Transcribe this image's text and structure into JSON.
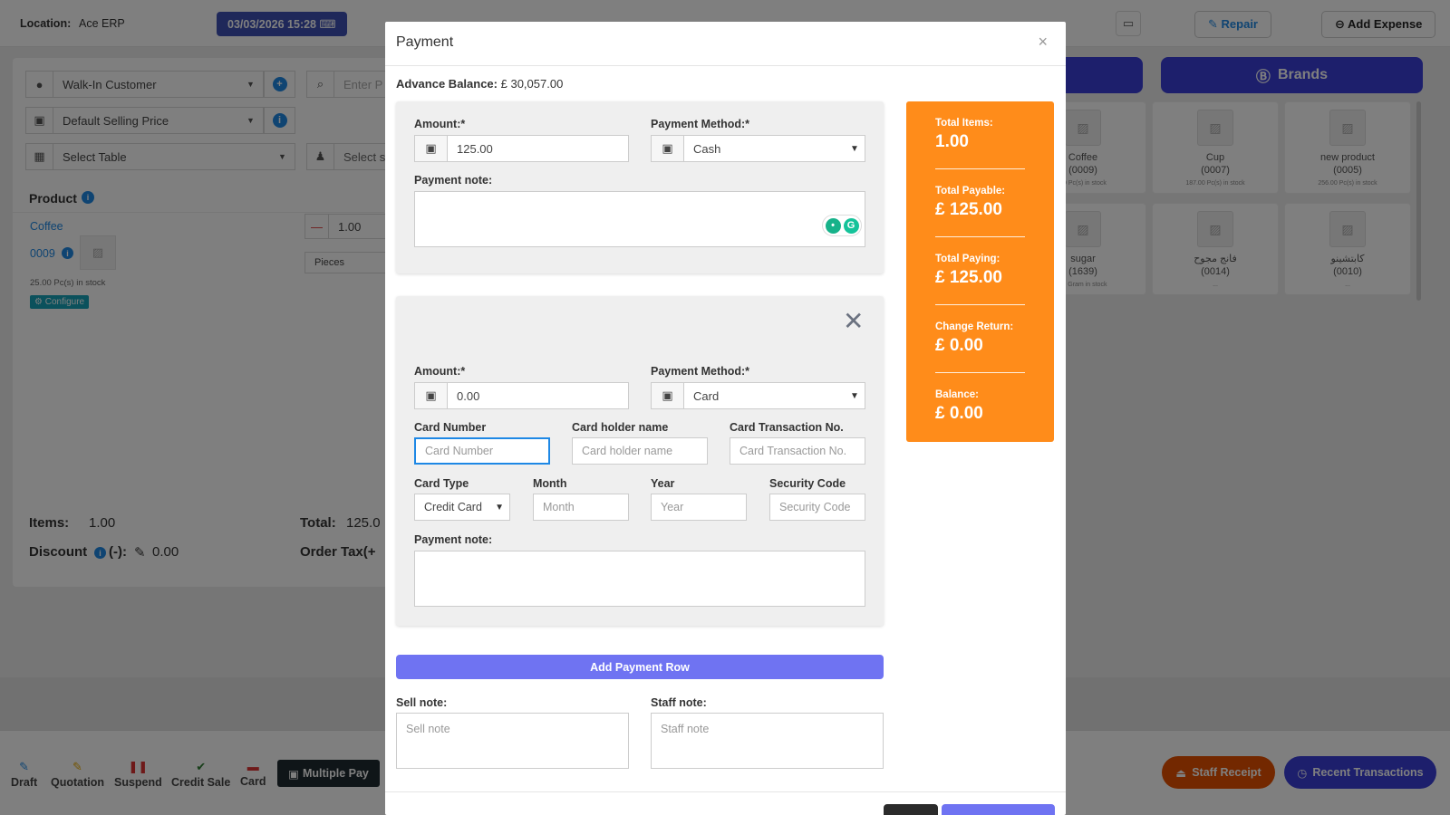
{
  "header": {
    "location_label": "Location:",
    "location_value": "Ace ERP",
    "datetime": "03/03/2026 15:28",
    "repair_label": "Repair",
    "add_expense_label": "Add Expense"
  },
  "left_panel": {
    "customer": "Walk-In Customer",
    "price_group": "Default Selling Price",
    "table_placeholder": "Select Table",
    "search_placeholder": "Enter P",
    "service_placeholder": "Select s",
    "product_header": "Product",
    "product_name": "Coffee",
    "product_code": "0009",
    "product_stock": "25.00 Pc(s) in stock",
    "configure_label": "Configure",
    "qty_value": "1.00",
    "unit": "Pieces",
    "items_label": "Items:",
    "items_value": "1.00",
    "total_label": "Total:",
    "total_value": "125.0",
    "discount_label": "Discount",
    "discount_sign": "(-):",
    "discount_value": "0.00",
    "order_tax_label": "Order Tax(+"
  },
  "right_panel": {
    "brands_label": "Brands",
    "products": [
      {
        "name": "Coffee",
        "code": "(0009)",
        "stock": "00 Pc(s) in stock"
      },
      {
        "name": "Cup",
        "code": "(0007)",
        "stock": "187.00 Pc(s) in stock"
      },
      {
        "name": "new product",
        "code": "(0005)",
        "stock": "256.00 Pc(s) in stock"
      },
      {
        "name": "sugar",
        "code": "(1639)",
        "stock": "00 Gram in stock"
      },
      {
        "name": "فانج مجوح",
        "code": "(0014)",
        "stock": "..."
      },
      {
        "name": "كابتشينو",
        "code": "(0010)",
        "stock": "..."
      }
    ]
  },
  "bottom_bar": {
    "draft": "Draft",
    "quotation": "Quotation",
    "suspend": "Suspend",
    "credit_sale": "Credit Sale",
    "card": "Card",
    "multiple_pay": "Multiple Pay",
    "staff_receipt": "Staff Receipt",
    "recent_transactions": "Recent Transactions"
  },
  "modal": {
    "title": "Payment",
    "close": "×",
    "advance_label": "Advance Balance:",
    "advance_value": "£ 30,057.00",
    "row1": {
      "amount_label": "Amount:*",
      "amount_value": "125.00",
      "method_label": "Payment Method:*",
      "method_value": "Cash",
      "note_label": "Payment note:"
    },
    "row2": {
      "amount_label": "Amount:*",
      "amount_value": "0.00",
      "method_label": "Payment Method:*",
      "method_value": "Card",
      "card_number_label": "Card Number",
      "card_number_placeholder": "Card Number",
      "holder_label": "Card holder name",
      "holder_placeholder": "Card holder name",
      "txn_label": "Card Transaction No.",
      "txn_placeholder": "Card Transaction No.",
      "card_type_label": "Card Type",
      "card_type_value": "Credit Card",
      "month_label": "Month",
      "month_placeholder": "Month",
      "year_label": "Year",
      "year_placeholder": "Year",
      "security_label": "Security Code",
      "security_placeholder": "Security Code",
      "note_label": "Payment note:"
    },
    "add_row_label": "Add Payment Row",
    "sell_note_label": "Sell note:",
    "sell_note_placeholder": "Sell note",
    "staff_note_label": "Staff note:",
    "staff_note_placeholder": "Staff note",
    "summary": [
      {
        "label": "Total Items:",
        "value": "1.00"
      },
      {
        "label": "Total Payable:",
        "value": "£ 125.00"
      },
      {
        "label": "Total Paying:",
        "value": "£ 125.00"
      },
      {
        "label": "Change Return:",
        "value": "£ 0.00"
      },
      {
        "label": "Balance:",
        "value": "£ 0.00"
      }
    ]
  },
  "colors": {
    "summary_bg": "#ff8c1a",
    "add_row_bg": "#6f73f2",
    "date_badge": "#3f51b5",
    "brands_bg": "#3b3fd9"
  }
}
